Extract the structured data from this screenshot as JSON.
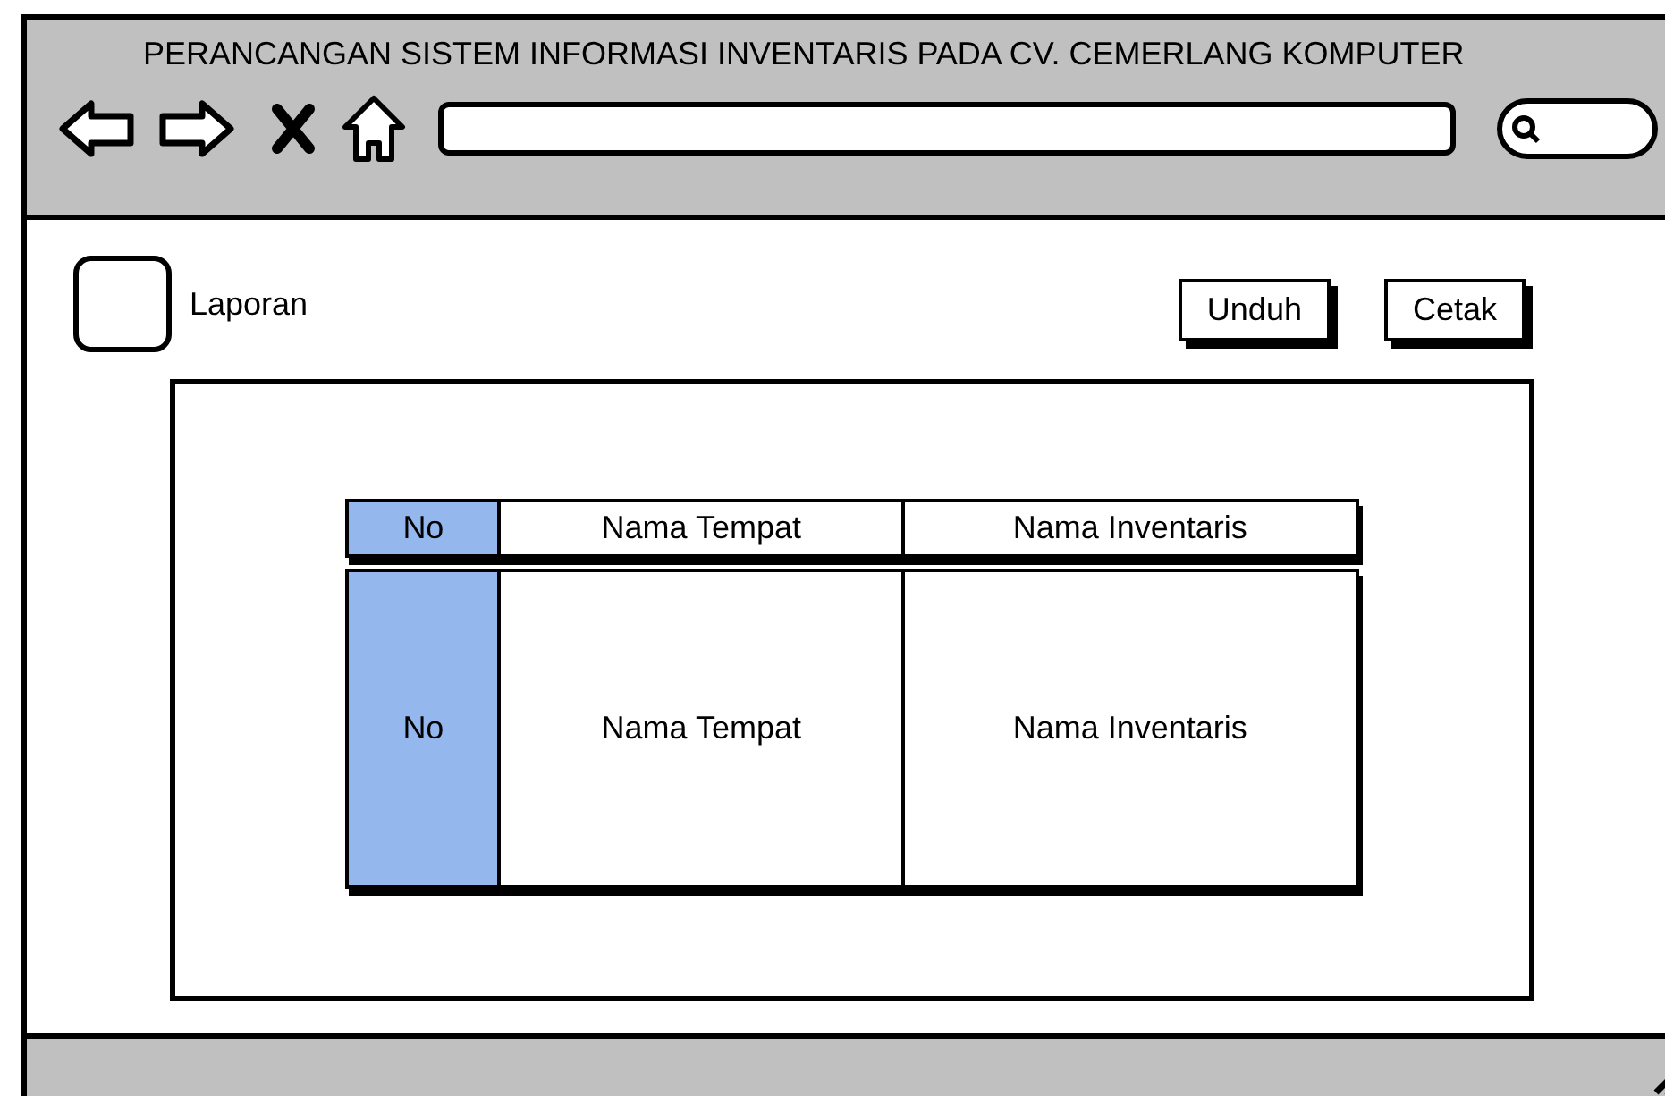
{
  "window": {
    "title": "PERANCANGAN SISTEM INFORMASI INVENTARIS PADA CV. CEMERLANG KOMPUTER"
  },
  "checkbox": {
    "label": "Laporan",
    "checked": false
  },
  "buttons": [
    "Unduh",
    "Cetak"
  ],
  "table": {
    "columns": [
      {
        "label": "No",
        "highlighted": true
      },
      {
        "label": "Nama Tempat",
        "highlighted": false
      },
      {
        "label": "Nama Inventaris",
        "highlighted": false
      }
    ],
    "rows": [
      {
        "cells": [
          "No",
          "Nama Tempat",
          "Nama Inventaris"
        ]
      }
    ]
  }
}
